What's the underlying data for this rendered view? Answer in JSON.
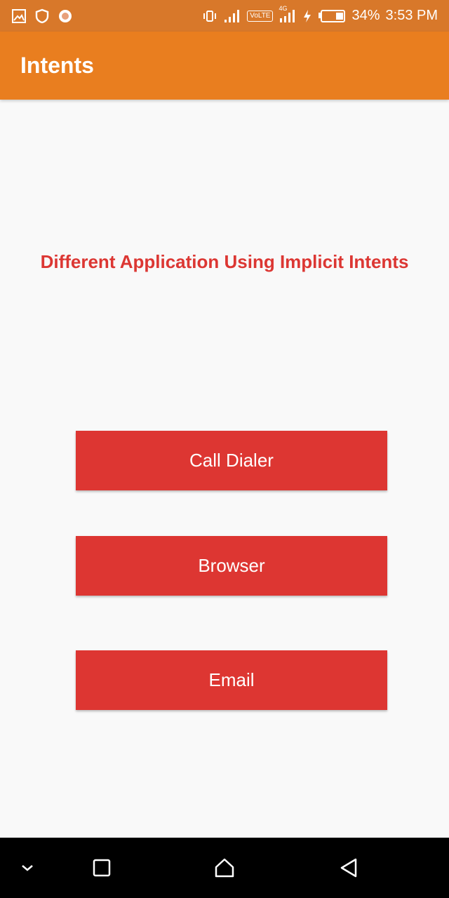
{
  "status_bar": {
    "battery_percent": "34%",
    "time": "3:53 PM",
    "volte_label": "VoLTE",
    "network_label": "4G",
    "icons": [
      "image-icon",
      "shield-icon",
      "circle-icon",
      "vibrate-icon",
      "signal-icon",
      "volte-icon",
      "signal-4g-icon",
      "charging-icon",
      "battery-icon"
    ]
  },
  "app_bar": {
    "title": "Intents",
    "color": "#e97e1f"
  },
  "main": {
    "heading": "Different Application Using Implicit Intents",
    "heading_color": "#dc3733",
    "buttons": [
      {
        "label": "Call Dialer"
      },
      {
        "label": "Browser"
      },
      {
        "label": "Email"
      }
    ],
    "button_color": "#dd3632"
  },
  "nav_bar": {
    "icons": [
      "chevron-down-icon",
      "recent-apps-icon",
      "home-icon",
      "back-icon"
    ]
  }
}
